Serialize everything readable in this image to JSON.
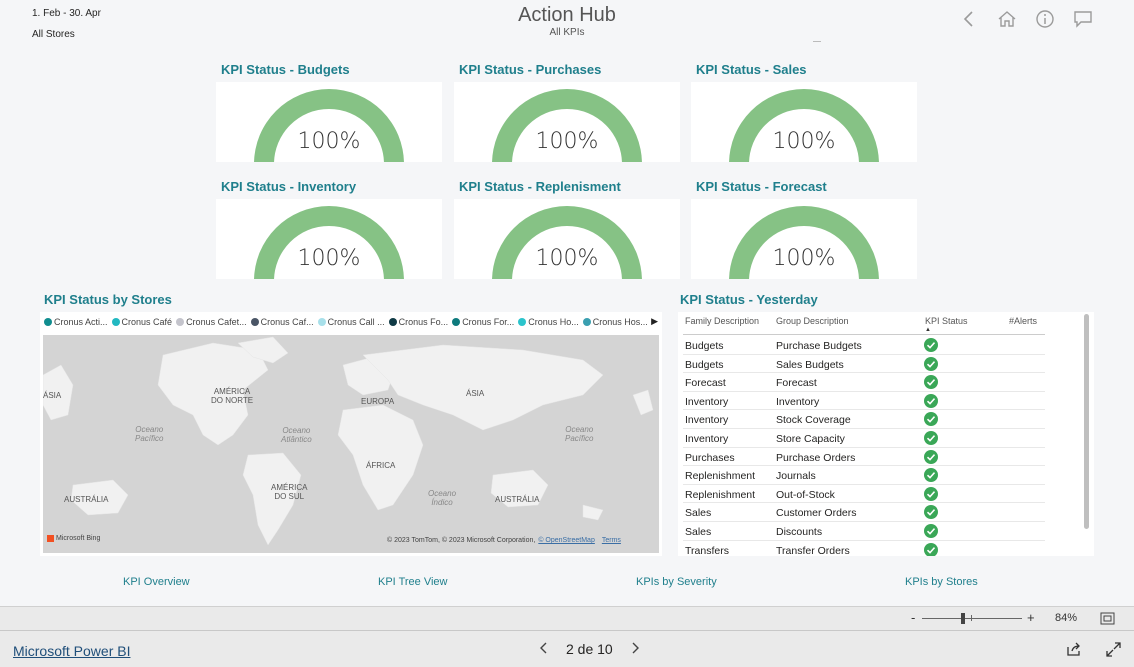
{
  "filters": {
    "date_range": "1. Feb - 30. Apr",
    "stores": "All Stores"
  },
  "header": {
    "title": "Action Hub",
    "subtitle": "All KPIs"
  },
  "kpis": [
    {
      "title": "KPI Status - Budgets",
      "value": "100%",
      "fill": 1.0
    },
    {
      "title": "KPI Status - Purchases",
      "value": "100%",
      "fill": 1.0
    },
    {
      "title": "KPI Status - Sales",
      "value": "100%",
      "fill": 1.0
    },
    {
      "title": "KPI Status - Inventory",
      "value": "100%",
      "fill": 1.0
    },
    {
      "title": "KPI Status - Replenisment",
      "value": "100%",
      "fill": 1.0
    },
    {
      "title": "KPI Status - Forecast",
      "value": "100%",
      "fill": 1.0
    }
  ],
  "gauge_color": "#86c285",
  "map_section": {
    "title": "KPI Status by Stores",
    "legend": [
      {
        "label": "Cronus Acti...",
        "color": "#118d8f"
      },
      {
        "label": "Cronus Café",
        "color": "#22b8c1"
      },
      {
        "label": "Cronus Cafet...",
        "color": "#c4c4cc"
      },
      {
        "label": "Cronus Caf...",
        "color": "#4a5566"
      },
      {
        "label": "Cronus Call ...",
        "color": "#a8e0ea"
      },
      {
        "label": "Cronus Fo...",
        "color": "#0f3a45"
      },
      {
        "label": "Cronus For...",
        "color": "#0e7a7d"
      },
      {
        "label": "Cronus Ho...",
        "color": "#2bc4cc"
      },
      {
        "label": "Cronus Hos...",
        "color": "#3a9fb0"
      }
    ],
    "labels": {
      "america_norte": "AMÉRICA\nDO NORTE",
      "europa": "EUROPA",
      "asia": "ÁSIA",
      "africa": "ÁFRICA",
      "america_sul": "AMÉRICA\nDO SUL",
      "australia_left": "AUSTRÁLIA",
      "australia_right": "AUSTRÁLIA",
      "asia_left": "ÁSIA",
      "ocean_pacific_left": "Oceano\nPacífico",
      "ocean_pacific_right": "Oceano\nPacífico",
      "ocean_atlantic": "Oceano\nAtlântico",
      "ocean_indian": "Oceano\nÍndico"
    },
    "bing": "Microsoft Bing",
    "copyright": "© 2023 TomTom, © 2023 Microsoft Corporation,",
    "osm": "© OpenStreetMap",
    "terms": "Terms"
  },
  "table_section": {
    "title": "KPI Status - Yesterday",
    "columns": [
      "Family Description",
      "Group Description",
      "KPI Status",
      "#Alerts"
    ],
    "rows": [
      {
        "family": "Budgets",
        "group": "Purchase Budgets"
      },
      {
        "family": "Budgets",
        "group": "Sales Budgets"
      },
      {
        "family": "Forecast",
        "group": "Forecast"
      },
      {
        "family": "Inventory",
        "group": "Inventory"
      },
      {
        "family": "Inventory",
        "group": "Stock Coverage"
      },
      {
        "family": "Inventory",
        "group": "Store Capacity"
      },
      {
        "family": "Purchases",
        "group": "Purchase Orders"
      },
      {
        "family": "Replenishment",
        "group": "Journals"
      },
      {
        "family": "Replenishment",
        "group": "Out-of-Stock"
      },
      {
        "family": "Sales",
        "group": "Customer Orders"
      },
      {
        "family": "Sales",
        "group": "Discounts"
      },
      {
        "family": "Transfers",
        "group": "Transfer Orders"
      }
    ]
  },
  "page_links": [
    "KPI Overview",
    "KPI Tree View",
    "KPIs by Severity",
    "KPIs by Stores"
  ],
  "zoom": {
    "minus": "-",
    "plus": "+",
    "level": "84%"
  },
  "footer": {
    "brand": "Microsoft Power BI",
    "page_indicator": "2 de 10"
  }
}
